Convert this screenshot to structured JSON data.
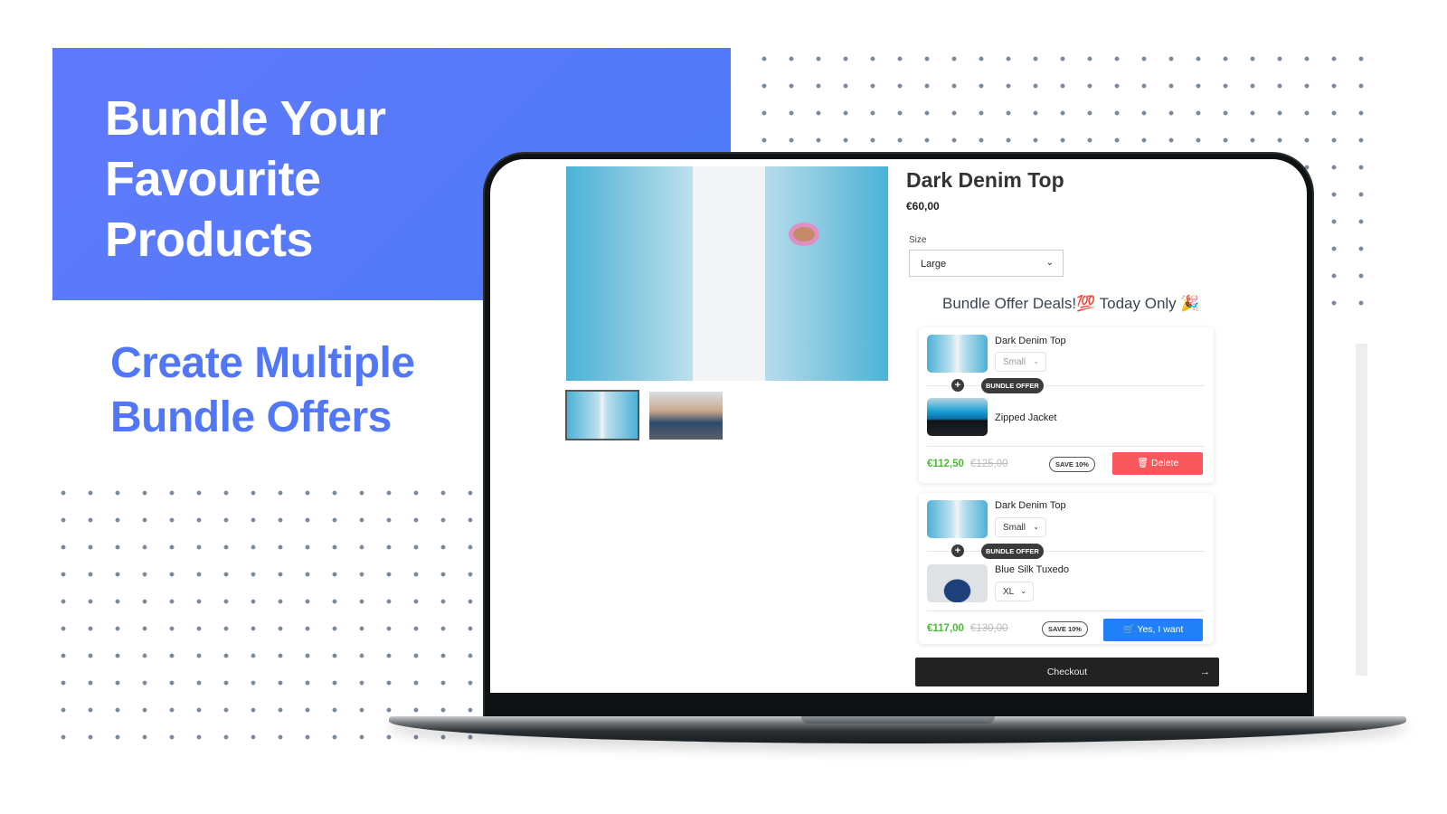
{
  "hero": {
    "title_lines": [
      "Bundle Your",
      "Favourite",
      "Products"
    ],
    "subtitle_lines": [
      "Create Multiple",
      "Bundle Offers"
    ]
  },
  "colors": {
    "hero_bg": "#5a79fa",
    "subtitle": "#5176f6",
    "price_green": "#4cb938",
    "delete_red": "#f8575b",
    "accept_blue": "#1f80f7",
    "checkout_dark": "#222222"
  },
  "product": {
    "title": "Dark Denim Top",
    "price": "€60,00",
    "size_label": "Size",
    "size_value": "Large",
    "images": [
      "denim-jacket-main",
      "woman-in-denim-jacket"
    ]
  },
  "bundle": {
    "heading": "Bundle Offer Deals!💯 Today Only 🎉",
    "badge_label": "BUNDLE OFFER",
    "offers": [
      {
        "items": [
          {
            "name": "Dark Denim Top",
            "variant": "Small",
            "image": "denim-jacket"
          },
          {
            "name": "Zipped Jacket",
            "variant": null,
            "image": "zipped-jacket"
          }
        ],
        "price": "€112,50",
        "original_price": "€125,00",
        "save_label": "SAVE 10%",
        "action_label": "Delete",
        "action_icon": "trash-icon"
      },
      {
        "items": [
          {
            "name": "Dark Denim Top",
            "variant": "Small",
            "image": "denim-jacket"
          },
          {
            "name": "Blue Silk Tuxedo",
            "variant": "XL",
            "image": "blue-tuxedo"
          }
        ],
        "price": "€117,00",
        "original_price": "€130,00",
        "save_label": "SAVE 10%",
        "action_label": "Yes, I want",
        "action_icon": "cart-icon"
      }
    ]
  },
  "checkout": {
    "label": "Checkout",
    "arrow": "→"
  }
}
